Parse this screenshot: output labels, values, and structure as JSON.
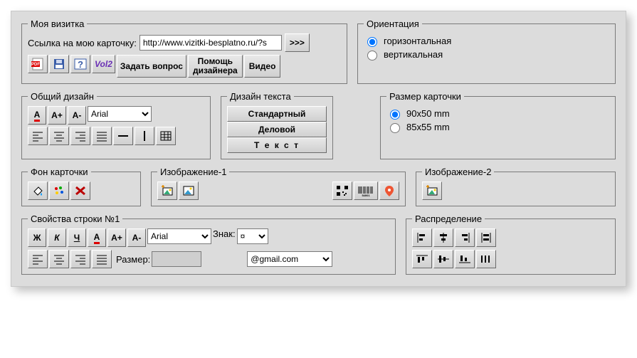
{
  "card": {
    "legend": "Моя визитка",
    "link_label": "Ссылка на мою карточку:",
    "link_value": "http://www.vizitki-besplatno.ru/?s",
    "go_label": ">>>",
    "ask_label": "Задать вопрос",
    "help_label_l1": "Помощь",
    "help_label_l2": "дизайнера",
    "video_label": "Видео",
    "vol_label": "Vol2"
  },
  "orientation": {
    "legend": "Ориентация",
    "options": [
      "горизонтальная",
      "вертикальная"
    ],
    "selected": 0
  },
  "design": {
    "legend": "Общий дизайн",
    "font": "Arial",
    "btn_A": "A",
    "btn_Aplus": "A+",
    "btn_Aminus": "A-"
  },
  "textdesign": {
    "legend": "Дизайн текста",
    "standard": "Стандартный",
    "business": "Деловой",
    "text": "Т е к с т"
  },
  "size": {
    "legend": "Размер карточки",
    "options": [
      "90x50 mm",
      "85x55 mm"
    ],
    "selected": 0
  },
  "bg": {
    "legend": "Фон карточки"
  },
  "img1": {
    "legend": "Изображение-1"
  },
  "img2": {
    "legend": "Изображение-2"
  },
  "line1": {
    "legend": "Свойства строки №1",
    "bold": "Ж",
    "italic": "К",
    "underline": "Ч",
    "A": "A",
    "Aplus": "A+",
    "Aminus": "A-",
    "font": "Arial",
    "char_label": "Знак:",
    "char_value": "¤",
    "size_label": "Размер:",
    "email_value": "@gmail.com"
  },
  "distribute": {
    "legend": "Распределение"
  },
  "icons": {
    "pdf": "pdf-icon",
    "save": "save-icon",
    "help": "help-icon",
    "alignL": "align-left-icon",
    "alignC": "align-center-icon",
    "alignR": "align-right-icon",
    "alignJ": "align-justify-icon",
    "hr": "horizontal-rule-icon",
    "vr": "vertical-rule-icon",
    "grid": "grid-icon",
    "fill": "fill-icon",
    "palette": "palette-icon",
    "delete": "delete-icon",
    "imgAdd": "image-add-icon",
    "imgPick": "image-pick-icon",
    "qr": "qr-icon",
    "barcode": "barcode-icon",
    "pin": "location-icon"
  }
}
